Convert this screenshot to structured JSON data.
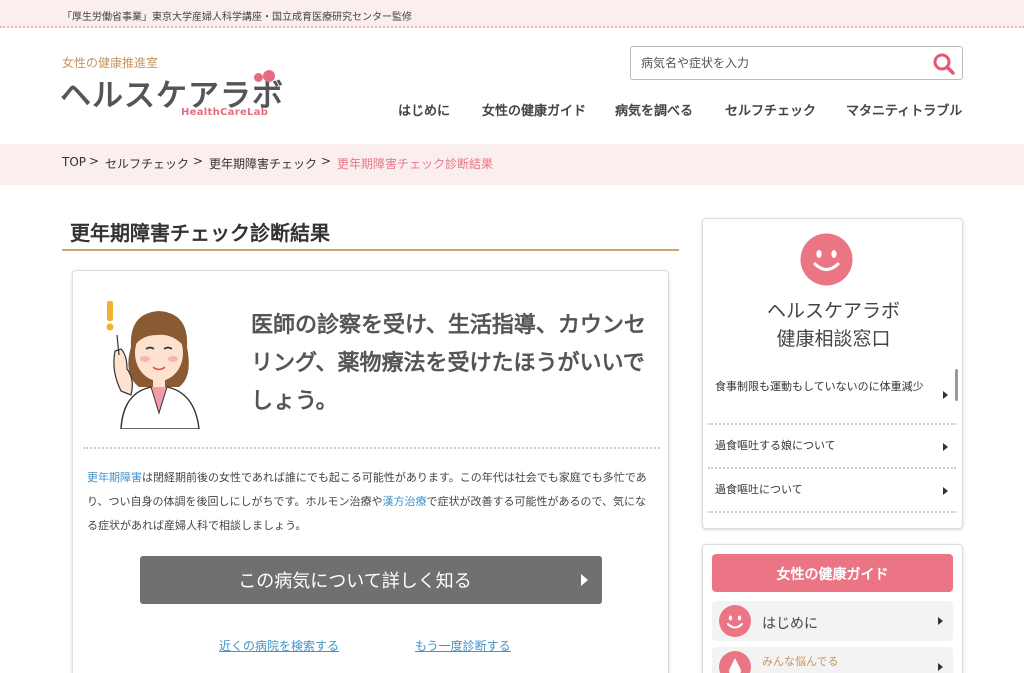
{
  "topbar": {
    "text": "「厚生労働省事業」東京大学産婦人科学講座・国立成育医療研究センター監修"
  },
  "logo": {
    "tagline": "女性の健康推進室",
    "name": "ヘルスケアラボ",
    "sub": "HealthCareLab"
  },
  "search": {
    "placeholder": "病気名や症状を入力"
  },
  "nav": [
    "はじめに",
    "女性の健康ガイド",
    "病気を調べる",
    "セルフチェック",
    "マタニティトラブル"
  ],
  "breadcrumb": {
    "items": [
      "TOP",
      "セルフチェック",
      "更年期障害チェック"
    ],
    "separator": ">",
    "current": "更年期障害チェック診断結果"
  },
  "main": {
    "title": "更年期障害チェック診断結果",
    "verdict": "医師の診察を受け、生活指導、カウンセリング、薬物療法を受けたほうがいいでしょう。",
    "body": {
      "link1": "更年期障害",
      "text1": "は閉経期前後の女性であれば誰にでも起こる可能性があります。この年代は社会でも家庭でも多忙であり、つい自身の体調を後回しにしがちです。ホルモン治療や",
      "link2": "漢方治療",
      "text2": "で症状が改善する可能性があるので、気になる症状があれば産婦人科で相談しましょう。"
    },
    "detail_button": "この病気について詳しく知る",
    "link_hospital": "近くの病院を検索する",
    "link_retry": "もう一度診断する"
  },
  "consult": {
    "title_line1": "ヘルスケアラボ",
    "title_line2": "健康相談窓口",
    "questions": [
      "食事制限も運動もしていないのに体重減少",
      "過食嘔吐する娘について",
      "過食嘔吐について"
    ]
  },
  "guide": {
    "header": "女性の健康ガイド",
    "items": [
      {
        "label": "はじめに"
      },
      {
        "label": "みんな悩んでる"
      }
    ]
  },
  "colors": {
    "accent": "#ec7585",
    "gold": "#c9a96e",
    "link": "#3f93c9",
    "pink_bg": "#fbeeee"
  }
}
